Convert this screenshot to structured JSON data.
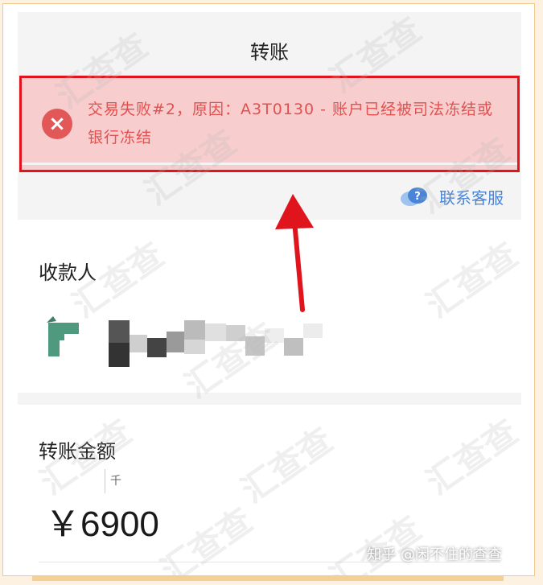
{
  "nav": {
    "title": "转账"
  },
  "error": {
    "icon": "close-icon",
    "message": "交易失败#2，原因：A3T0130 - 账户已经被司法冻结或银行冻结"
  },
  "service": {
    "icon": "chat-help-icon",
    "label": "联系客服"
  },
  "payee": {
    "label": "收款人"
  },
  "amount": {
    "label": "转账金额",
    "unit_hint": "千",
    "value": "￥6900"
  },
  "watermark": {
    "text": "汇查查"
  },
  "footer": {
    "credit": "知乎 @闲不住的查查"
  },
  "colors": {
    "error_red": "#e0141c",
    "error_bg": "#f7cdcd",
    "link_blue": "#4a84d6",
    "avatar_green": "#4f9a7e"
  }
}
